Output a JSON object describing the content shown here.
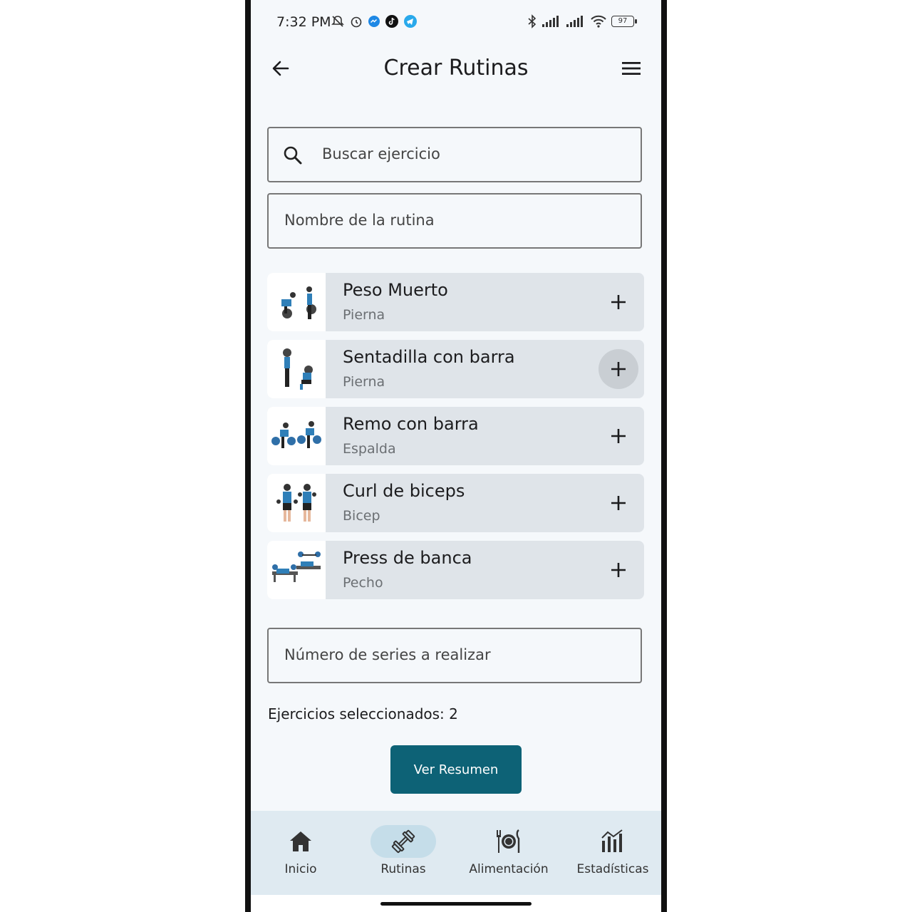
{
  "status_bar": {
    "time": "7:32 PM",
    "battery": "97"
  },
  "app_bar": {
    "title": "Crear Rutinas"
  },
  "search": {
    "placeholder": "Buscar ejercicio"
  },
  "routine_name": {
    "placeholder": "Nombre de la rutina"
  },
  "exercises": [
    {
      "name": "Peso Muerto",
      "category": "Pierna"
    },
    {
      "name": "Sentadilla con barra",
      "category": "Pierna"
    },
    {
      "name": "Remo con barra",
      "category": "Espalda"
    },
    {
      "name": "Curl de biceps",
      "category": "Bicep"
    },
    {
      "name": "Press de banca",
      "category": "Pecho"
    }
  ],
  "series": {
    "placeholder": "Número de series a realizar"
  },
  "selected": {
    "text": "Ejercicios seleccionados: 2"
  },
  "summary_button": {
    "label": "Ver Resumen"
  },
  "nav": [
    {
      "label": "Inicio",
      "icon": "home-icon"
    },
    {
      "label": "Rutinas",
      "icon": "dumbbell-icon",
      "active": true
    },
    {
      "label": "Alimentación",
      "icon": "plate-icon"
    },
    {
      "label": "Estadísticas",
      "icon": "stats-icon"
    }
  ],
  "colors": {
    "primary": "#0d6276",
    "background": "#f5f8fb",
    "card": "#dfe4e9",
    "nav_bg": "#dfeaf1",
    "nav_active": "#c5dde9"
  }
}
